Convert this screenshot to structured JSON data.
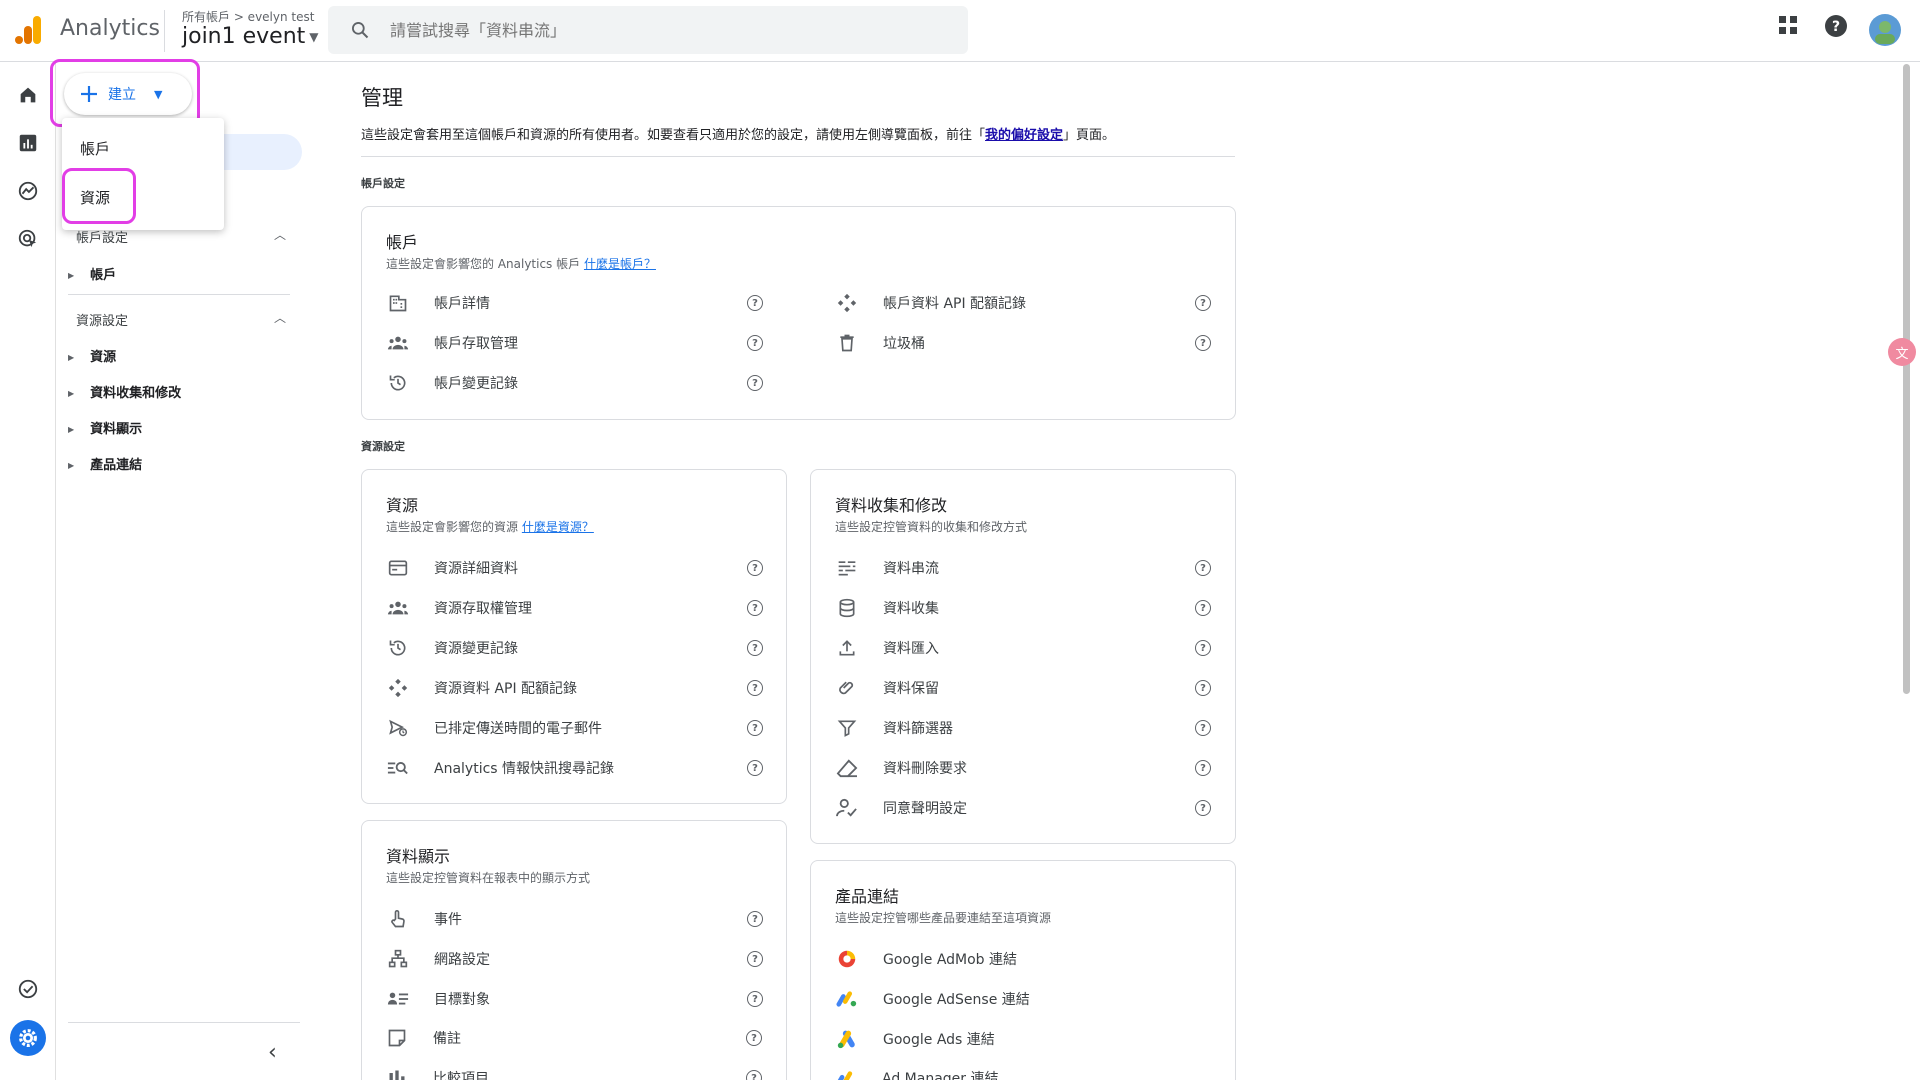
{
  "header": {
    "app_name": "Analytics",
    "breadcrumb": "所有帳戶 > evelyn test",
    "property": "join1 event",
    "search_placeholder": "請嘗試搜尋「資料串流」"
  },
  "create": {
    "label": "建立",
    "menu": [
      "帳戶",
      "資源"
    ]
  },
  "sidebar": {
    "account_section": "帳戶設定",
    "account_items": [
      "帳戶"
    ],
    "property_section": "資源設定",
    "property_items": [
      "資源",
      "資料收集和修改",
      "資料顯示",
      "產品連結"
    ]
  },
  "main": {
    "title": "管理",
    "desc_before": "這些設定會套用至這個帳戶和資源的所有使用者。如要查看只適用於您的設定，請使用左側導覽面板，前往「",
    "desc_link": "我的偏好設定",
    "desc_after": "」頁面。",
    "account_group": "帳戶設定",
    "property_group": "資源設定"
  },
  "account_card": {
    "title": "帳戶",
    "subtitle": "這些設定會影響您的 Analytics 帳戶",
    "link": "什麼是帳戶？",
    "left": [
      "帳戶詳情",
      "帳戶存取管理",
      "帳戶變更記錄"
    ],
    "right": [
      "帳戶資料 API 配額記錄",
      "垃圾桶"
    ]
  },
  "property_card": {
    "title": "資源",
    "subtitle": "這些設定會影響您的資源",
    "link": "什麼是資源？",
    "items": [
      "資源詳細資料",
      "資源存取權管理",
      "資源變更記錄",
      "資源資料 API 配額記錄",
      "已排定傳送時間的電子郵件",
      "Analytics 情報快訊搜尋記錄"
    ]
  },
  "collection_card": {
    "title": "資料收集和修改",
    "subtitle": "這些設定控管資料的收集和修改方式",
    "items": [
      "資料串流",
      "資料收集",
      "資料匯入",
      "資料保留",
      "資料篩選器",
      "資料刪除要求",
      "同意聲明設定"
    ]
  },
  "display_card": {
    "title": "資料顯示",
    "subtitle": "這些設定控管資料在報表中的顯示方式",
    "items": [
      "事件",
      "網路設定",
      "目標對象",
      "備註",
      "比較項目"
    ]
  },
  "links_card": {
    "title": "產品連結",
    "subtitle": "這些設定控管哪些產品要連結至這項資源",
    "items": [
      "Google AdMob 連結",
      "Google AdSense 連結",
      "Google Ads 連結",
      "Ad Manager 連結"
    ]
  },
  "colors": {
    "accent": "#1a73e8",
    "highlight": "#e23ee6"
  }
}
